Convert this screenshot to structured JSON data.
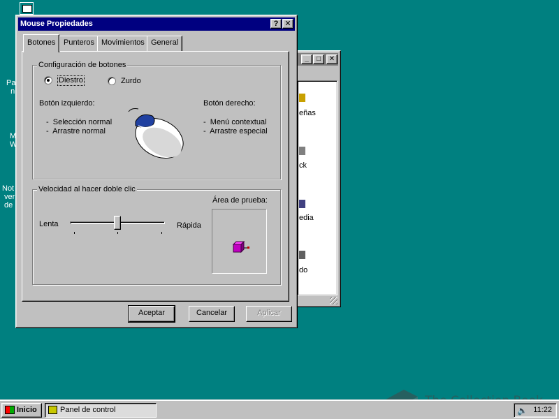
{
  "desktop": {
    "left_labels": [
      {
        "text": "Pa\n  n"
      },
      {
        "text": "M\nW"
      },
      {
        "text": "Not\n ver\n de"
      }
    ]
  },
  "background_window": {
    "fragments": [
      "eñas",
      "ck",
      "edia",
      "do"
    ]
  },
  "dialog": {
    "title": "Mouse Propiedades",
    "help_button": "?",
    "close_button": "✕",
    "tabs": [
      "Botones",
      "Punteros",
      "Movimientos",
      "General"
    ],
    "active_tab": 0,
    "buttons_group": {
      "title": "Configuración de botones",
      "options": [
        "Diestro",
        "Zurdo"
      ],
      "selected": 0,
      "left_button": {
        "title": "Botón izquierdo:",
        "items": [
          "Selección normal",
          "Arrastre normal"
        ]
      },
      "right_button": {
        "title": "Botón derecho:",
        "items": [
          "Menú contextual",
          "Arrastre especial"
        ]
      }
    },
    "double_click_group": {
      "title": "Velocidad al hacer doble clic",
      "slow_label": "Lenta",
      "fast_label": "Rápida",
      "slider_fraction": 0.5,
      "test_area_label": "Área de prueba:"
    },
    "actions": {
      "ok": "Aceptar",
      "cancel": "Cancelar",
      "apply": "Aplicar"
    }
  },
  "taskbar": {
    "start_label": "Inicio",
    "task_label": "Panel de control",
    "clock": "11:22"
  },
  "watermark": "The Collection Book",
  "colors": {
    "desktop": "#008080",
    "titlebar_active": "#000080",
    "titlebar_inactive": "#808080",
    "face": "#c0c0c0"
  }
}
